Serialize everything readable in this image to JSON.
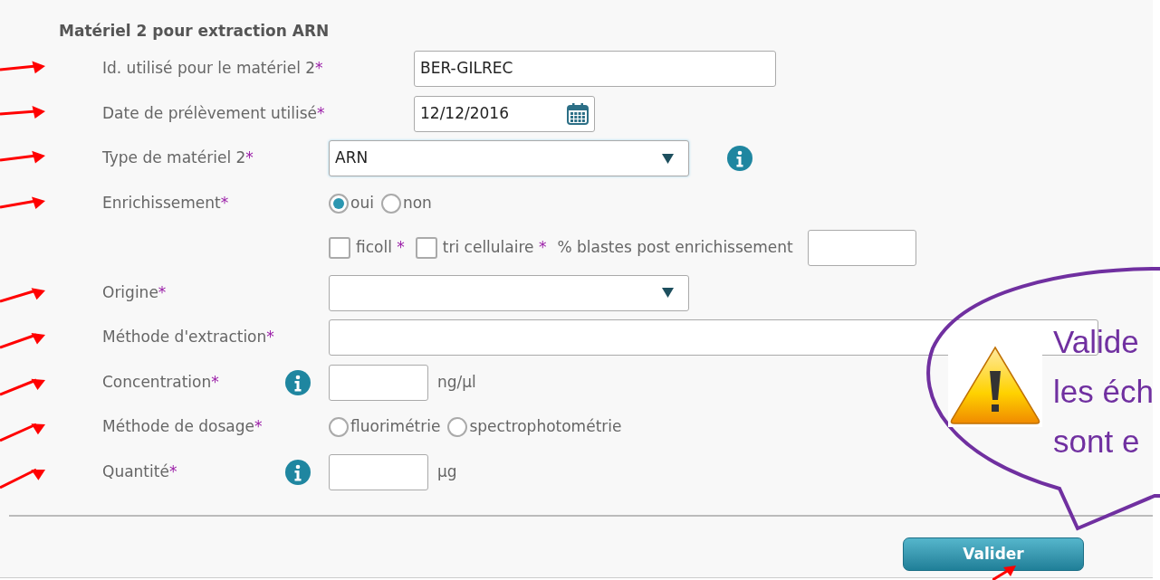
{
  "section_title": "Matériel 2 pour extraction ARN",
  "fields": [
    {
      "kind": "text",
      "label": "Id. utilisé pour le matériel 2",
      "mark": "*",
      "annotated": true,
      "value": "BER-GILREC"
    },
    {
      "kind": "date",
      "label": "Date de prélèvement utilisé",
      "mark": "*",
      "annotated": true,
      "value": "12/12/2016"
    },
    {
      "kind": "select",
      "label": "Type de matériel 2",
      "mark": "*",
      "annotated": true,
      "value": "ARN",
      "focused": true,
      "info": true
    },
    {
      "kind": "radio",
      "label": "Enrichissement",
      "mark": "*",
      "annotated": true,
      "options": [
        {
          "label": "oui",
          "selected": true
        },
        {
          "label": "non",
          "selected": false
        }
      ]
    },
    {
      "kind": "checks",
      "annotated": false,
      "items": [
        {
          "label": "ficoll",
          "mark": "*",
          "checked": false
        },
        {
          "label": "tri cellulaire",
          "mark": "*",
          "checked": false
        }
      ],
      "trailing_label": "% blastes post enrichissement"
    },
    {
      "kind": "select",
      "label": "Origine",
      "mark": "*",
      "annotated": true,
      "focused": false
    },
    {
      "kind": "long-text",
      "label": "Méthode d'extraction",
      "mark": "*",
      "annotated": true
    },
    {
      "kind": "unit",
      "label": "Concentration",
      "mark": "*",
      "annotated": true,
      "info": true,
      "unit": "ng/µl"
    },
    {
      "kind": "radio",
      "label": "Méthode de dosage",
      "mark": "*",
      "annotated": true,
      "options": [
        {
          "label": "fluorimétrie",
          "selected": false
        },
        {
          "label": "spectrophotométrie",
          "selected": false
        }
      ]
    },
    {
      "kind": "unit",
      "label": "Quantité",
      "mark": "*",
      "annotated": true,
      "info": true,
      "unit": "µg"
    }
  ],
  "buttons": [
    {
      "label": "Valider",
      "annotated": true
    }
  ],
  "callout": {
    "lines": [
      "Valide",
      "les éch",
      "sont e"
    ],
    "warning": true
  }
}
